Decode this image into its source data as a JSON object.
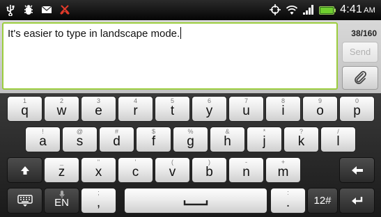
{
  "status_bar": {
    "clock_time": "4:41",
    "clock_ampm": "AM",
    "icons": [
      "usb-icon",
      "debug-icon",
      "mail-icon",
      "missed-call-icon",
      "gps-icon",
      "wifi-icon",
      "signal-icon",
      "battery-icon"
    ]
  },
  "compose": {
    "message_text": "It's easier to type in landscape mode.",
    "char_counter": "38/160",
    "send_label": "Send",
    "attach_icon": "paperclip-icon",
    "accent_color": "#9bcd3c"
  },
  "keyboard": {
    "row1": [
      {
        "alt": "1",
        "key": "q"
      },
      {
        "alt": "2",
        "key": "w"
      },
      {
        "alt": "3",
        "key": "e"
      },
      {
        "alt": "4",
        "key": "r"
      },
      {
        "alt": "5",
        "key": "t"
      },
      {
        "alt": "6",
        "key": "y"
      },
      {
        "alt": "7",
        "key": "u"
      },
      {
        "alt": "8",
        "key": "i"
      },
      {
        "alt": "9",
        "key": "o"
      },
      {
        "alt": "0",
        "key": "p"
      }
    ],
    "row2": [
      {
        "alt": "!",
        "key": "a"
      },
      {
        "alt": "@",
        "key": "s"
      },
      {
        "alt": "#",
        "key": "d"
      },
      {
        "alt": "$",
        "key": "f"
      },
      {
        "alt": "%",
        "key": "g"
      },
      {
        "alt": "&",
        "key": "h"
      },
      {
        "alt": "*",
        "key": "j"
      },
      {
        "alt": "?",
        "key": "k"
      },
      {
        "alt": "/",
        "key": "l"
      }
    ],
    "row3": [
      {
        "alt": "_",
        "key": "z"
      },
      {
        "alt": "\"",
        "key": "x"
      },
      {
        "alt": "'",
        "key": "c"
      },
      {
        "alt": "(",
        "key": "v"
      },
      {
        "alt": ")",
        "key": "b"
      },
      {
        "alt": "-",
        "key": "n"
      },
      {
        "alt": "+",
        "key": "m"
      }
    ],
    "shift_icon": "shift-arrow-icon",
    "backspace_icon": "backspace-arrow-icon",
    "keyboard_settings_icon": "keyboard-icon",
    "lang_key_label": "EN",
    "lang_key_icon": "microphone-icon",
    "comma_key": {
      "alt": ";",
      "key": ","
    },
    "space_icon": "space-bar-icon",
    "period_key": {
      "alt": ":",
      "key": "."
    },
    "symbols_key_label": "12#",
    "enter_icon": "enter-arrow-icon"
  }
}
